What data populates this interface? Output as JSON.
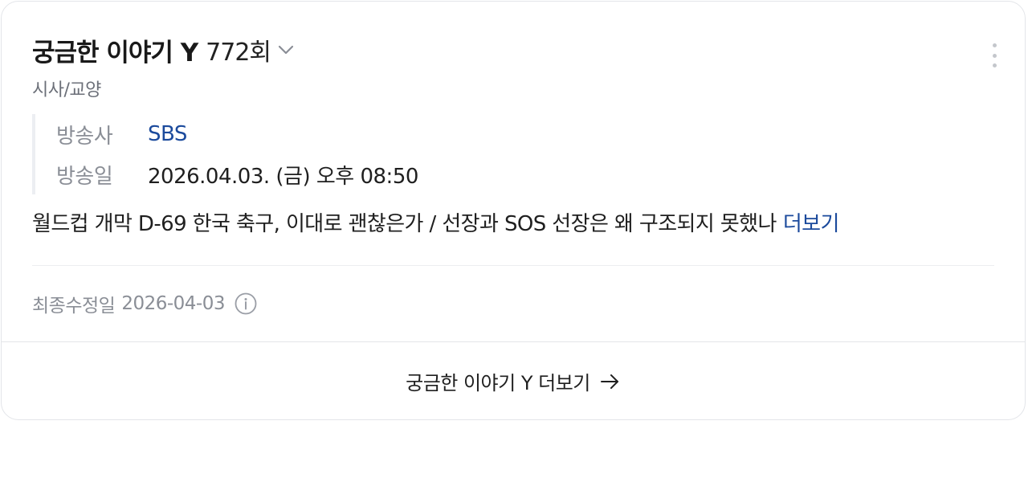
{
  "program": {
    "title": "궁금한 이야기 Y",
    "episode": "772회",
    "category": "시사/교양"
  },
  "info": {
    "broadcaster_label": "방송사",
    "broadcaster_value": "SBS",
    "airdate_label": "방송일",
    "airdate_value": "2026.04.03. (금) 오후 08:50"
  },
  "description": {
    "text": "월드컵 개막 D-69 한국 축구, 이대로 괜찮은가 / 선장과 SOS 선장은 왜 구조되지 못했나",
    "more_label": "더보기"
  },
  "updated": {
    "label": "최종수정일",
    "date": "2026-04-03"
  },
  "footer": {
    "link_label": "궁금한 이야기 Y 더보기"
  },
  "icons": {
    "episode_dropdown": "chevron-down-icon",
    "menu": "more-vertical-icon",
    "info": "info-icon",
    "footer_arrow": "arrow-right-icon"
  },
  "colors": {
    "link": "#1b4a9c",
    "muted": "#8a8e96"
  }
}
